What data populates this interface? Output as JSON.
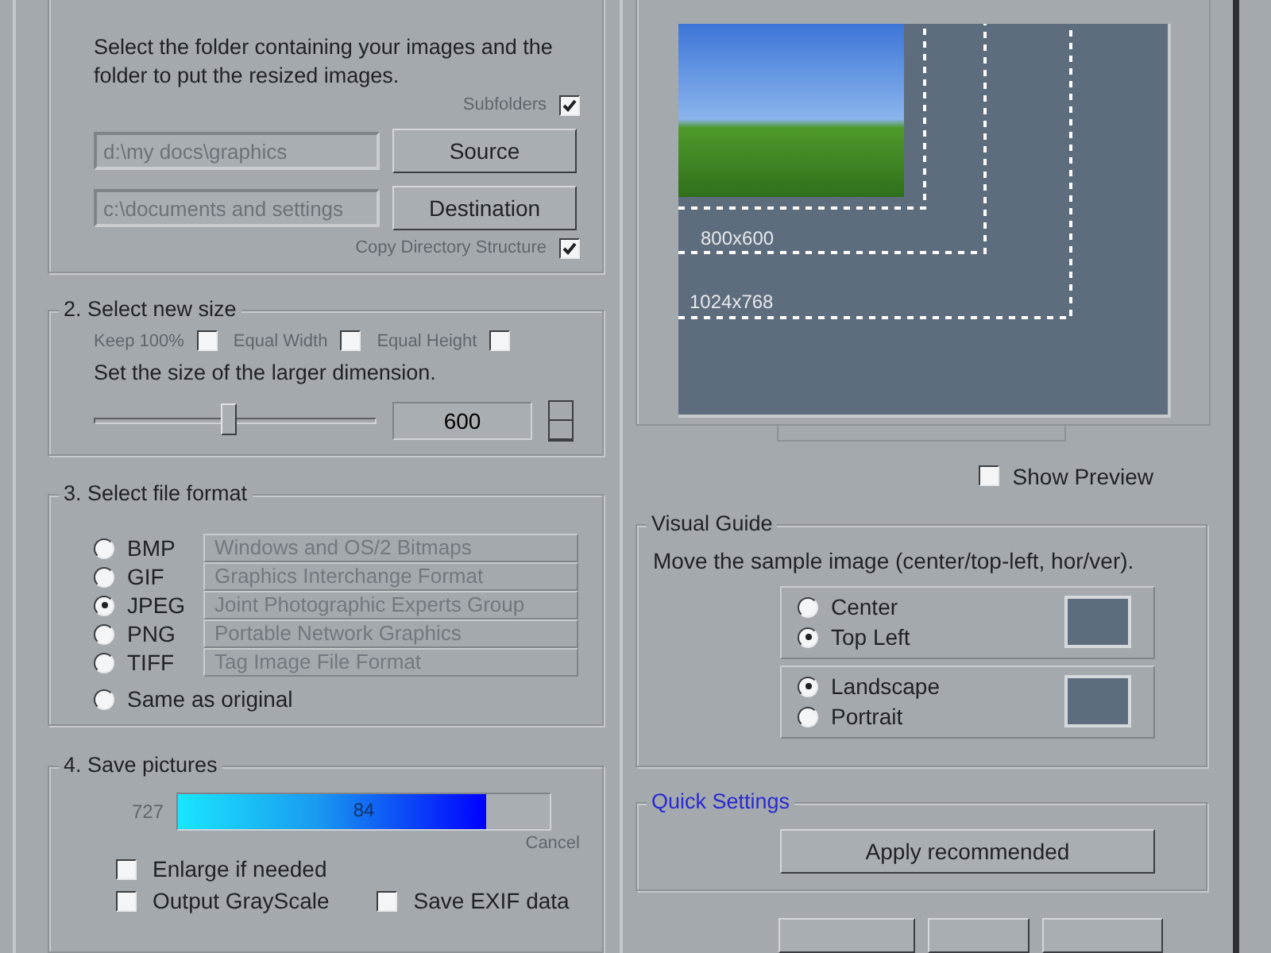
{
  "source_destination": {
    "description": "Select the folder containing your images and the folder to put the resized images.",
    "subfolders": {
      "label": "Subfolders",
      "checked": true
    },
    "source_path": "d:\\my docs\\graphics",
    "source_button": "Source",
    "destination_path": "c:\\documents and settings",
    "destination_button": "Destination",
    "copy_structure": {
      "label": "Copy Directory Structure",
      "checked": true
    }
  },
  "new_size": {
    "title": "2. Select new size",
    "options": [
      {
        "label": "Keep 100%",
        "checked": false
      },
      {
        "label": "Equal Width",
        "checked": false
      },
      {
        "label": "Equal Height",
        "checked": false
      }
    ],
    "instruction": "Set the size of the larger dimension.",
    "slider": {
      "level": 0.48
    },
    "value": "600"
  },
  "file_format": {
    "title": "3. Select file format",
    "formats": [
      {
        "label": "BMP",
        "description": "Windows and OS/2 Bitmaps",
        "selected": false
      },
      {
        "label": "GIF",
        "description": "Graphics Interchange Format",
        "selected": false
      },
      {
        "label": "JPEG",
        "description": "Joint Photographic Experts Group",
        "selected": true
      },
      {
        "label": "PNG",
        "description": "Portable Network Graphics",
        "selected": false
      },
      {
        "label": "TIFF",
        "description": "Tag Image File Format",
        "selected": false
      }
    ],
    "same_as_original": {
      "label": "Same as original",
      "selected": false
    }
  },
  "save_pictures": {
    "title": "4. Save pictures",
    "count": "727",
    "progress": {
      "level": 0.83,
      "label": "84"
    },
    "cancel": "Cancel",
    "options": [
      {
        "label": "Enlarge if needed",
        "checked": false
      },
      {
        "label": "Output GrayScale",
        "checked": false
      },
      {
        "label": "Save EXIF data",
        "checked": false
      }
    ]
  },
  "preview": {
    "labels": [
      "800x600",
      "1024x768"
    ],
    "show_preview": {
      "label": "Show Preview",
      "checked": false
    }
  },
  "visual_guide": {
    "title": "Visual Guide",
    "description": "Move the sample image (center/top-left, hor/ver).",
    "position": [
      {
        "label": "Center",
        "selected": false
      },
      {
        "label": "Top Left",
        "selected": true
      }
    ],
    "orientation": [
      {
        "label": "Landscape",
        "selected": true
      },
      {
        "label": "Portrait",
        "selected": false
      }
    ]
  },
  "quick_settings": {
    "title": "Quick Settings",
    "button": "Apply recommended"
  }
}
